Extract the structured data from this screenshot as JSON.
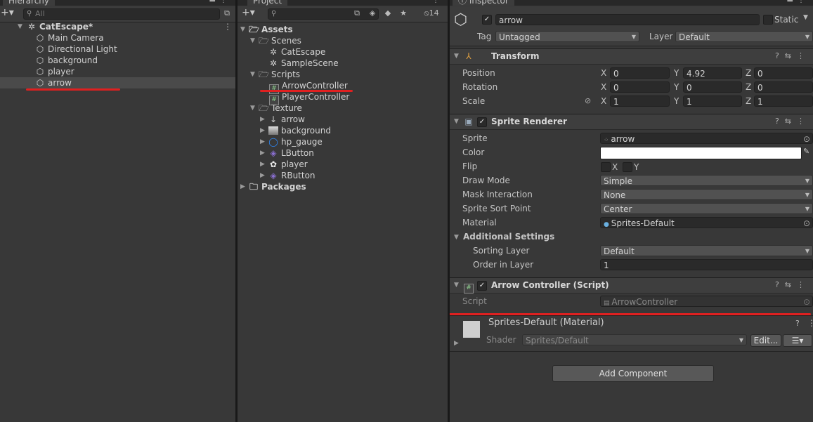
{
  "hierarchy": {
    "tab_label": "Hierarchy",
    "search_placeholder": "All",
    "scene_name": "CatEscape*",
    "items": [
      "Main Camera",
      "Directional Light",
      "background",
      "player",
      "arrow"
    ]
  },
  "project": {
    "tab_label": "Project",
    "hidden_count": "14",
    "assets_label": "Assets",
    "scenes_label": "Scenes",
    "scenes": [
      "CatEscape",
      "SampleScene"
    ],
    "scripts_label": "Scripts",
    "scripts": [
      "ArrowController",
      "PlayerController"
    ],
    "texture_label": "Texture",
    "textures": [
      "arrow",
      "background",
      "hp_gauge",
      "LButton",
      "player",
      "RButton"
    ],
    "packages_label": "Packages"
  },
  "inspector": {
    "tab_label": "Inspector",
    "object_name": "arrow",
    "static_label": "Static",
    "tag_label": "Tag",
    "tag_value": "Untagged",
    "layer_label": "Layer",
    "layer_value": "Default",
    "transform": {
      "title": "Transform",
      "position_label": "Position",
      "rotation_label": "Rotation",
      "scale_label": "Scale",
      "axis_x": "X",
      "axis_y": "Y",
      "axis_z": "Z",
      "position": [
        "0",
        "4.92",
        "0"
      ],
      "rotation": [
        "0",
        "0",
        "0"
      ],
      "scale": [
        "1",
        "1",
        "1"
      ]
    },
    "sprite_renderer": {
      "title": "Sprite Renderer",
      "sprite_label": "Sprite",
      "sprite_value": "arrow",
      "color_label": "Color",
      "color_value": "#ffffff",
      "flip_label": "Flip",
      "flip_x": "X",
      "flip_y": "Y",
      "draw_mode_label": "Draw Mode",
      "draw_mode_value": "Simple",
      "mask_label": "Mask Interaction",
      "mask_value": "None",
      "sort_point_label": "Sprite Sort Point",
      "sort_point_value": "Center",
      "material_label": "Material",
      "material_value": "Sprites-Default",
      "additional_label": "Additional Settings",
      "sorting_layer_label": "Sorting Layer",
      "sorting_layer_value": "Default",
      "order_label": "Order in Layer",
      "order_value": "1"
    },
    "arrow_controller": {
      "title": "Arrow Controller (Script)",
      "script_label": "Script",
      "script_value": "ArrowController"
    },
    "material": {
      "title": "Sprites-Default (Material)",
      "shader_label": "Shader",
      "shader_value": "Sprites/Default",
      "edit_label": "Edit..."
    },
    "add_component_label": "Add Component"
  },
  "colors": {
    "highlight_underline": "#e02020",
    "panel_bg": "#383838"
  }
}
